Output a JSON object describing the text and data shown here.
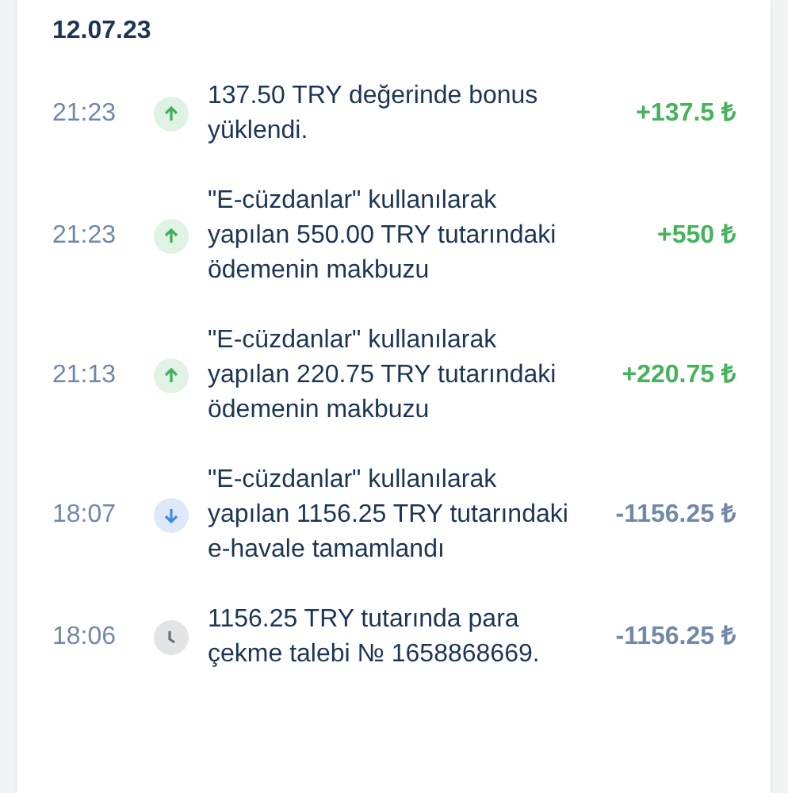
{
  "date": "12.07.23",
  "transactions": [
    {
      "time": "21:23",
      "kind": "in",
      "description": "137.50 TRY değerinde bonus yüklendi.",
      "amount": "+137.5 ₺"
    },
    {
      "time": "21:23",
      "kind": "in",
      "description": "\"E-cüzdanlar\" kullanılarak yapılan 550.00 TRY tutarındaki ödemenin makbuzu",
      "amount": "+550 ₺"
    },
    {
      "time": "21:13",
      "kind": "in",
      "description": "\"E-cüzdanlar\" kullanılarak yapılan 220.75 TRY tutarındaki ödemenin makbuzu",
      "amount": "+220.75 ₺"
    },
    {
      "time": "18:07",
      "kind": "out",
      "description": "\"E-cüzdanlar\" kullanılarak yapılan 1156.25 TRY tutarındaki e-havale tamamlandı",
      "amount": "-1156.25 ₺"
    },
    {
      "time": "18:06",
      "kind": "pending",
      "description": "1156.25 TRY tutarında para çekme talebi № 1658868669.",
      "amount": "-1156.25 ₺"
    }
  ]
}
